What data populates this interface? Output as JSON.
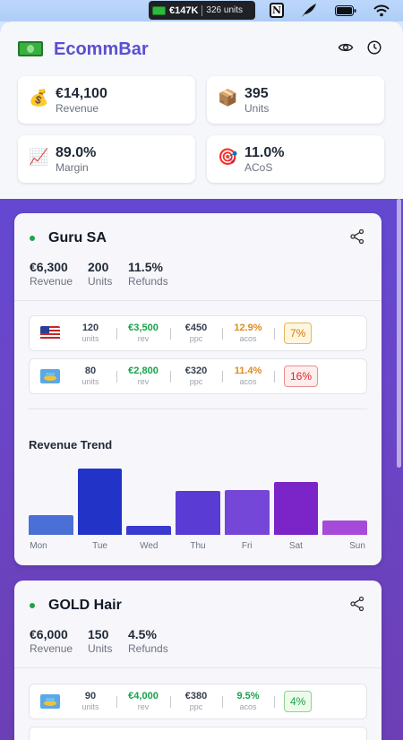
{
  "menubar": {
    "total": "€147K",
    "units": "326 units",
    "icons": [
      "cash-icon",
      "notion-icon",
      "feather-icon",
      "battery-icon",
      "wifi-icon"
    ],
    "notion_glyph": "N"
  },
  "app": {
    "title": "EcommBar",
    "accent": "#5b4ed2"
  },
  "stats": [
    {
      "emoji": "💰",
      "value": "€14,100",
      "label": "Revenue"
    },
    {
      "emoji": "📦",
      "value": "395",
      "label": "Units"
    },
    {
      "emoji": "📈",
      "value": "89.0%",
      "label": "Margin"
    },
    {
      "emoji": "🎯",
      "value": "11.0%",
      "label": "ACoS"
    }
  ],
  "products": [
    {
      "name": "Guru SA",
      "revenue": "€6,300",
      "revenue_label": "Revenue",
      "units": "200",
      "units_label": "Units",
      "refunds": "11.5%",
      "refunds_label": "Refunds",
      "markets": [
        {
          "flag": "us",
          "units": "120",
          "units_label": "units",
          "rev": "€3,500",
          "rev_label": "rev",
          "ppc": "€450",
          "ppc_label": "ppc",
          "acos": "12.9%",
          "acos_label": "acos",
          "pill": "7%",
          "pill_style": "orange"
        },
        {
          "flag": "sa",
          "units": "80",
          "units_label": "units",
          "rev": "€2,800",
          "rev_label": "rev",
          "ppc": "€320",
          "ppc_label": "ppc",
          "acos": "11.4%",
          "acos_label": "acos",
          "pill": "16%",
          "pill_style": "red"
        }
      ],
      "trend_title": "Revenue Trend",
      "chart_data": {
        "type": "bar",
        "categories": [
          "Mon",
          "Tue",
          "Wed",
          "Thu",
          "Fri",
          "Sat",
          "Sun"
        ],
        "values": [
          30,
          100,
          13,
          66,
          67,
          80,
          22
        ],
        "colors": [
          "#4a6fd6",
          "#2233c8",
          "#3a3ad0",
          "#5a3bd4",
          "#7447d8",
          "#7b24c8",
          "#a64ad9"
        ],
        "ylim": [
          0,
          100
        ]
      }
    },
    {
      "name": "GOLD Hair",
      "revenue": "€6,000",
      "revenue_label": "Revenue",
      "units": "150",
      "units_label": "Units",
      "refunds": "4.5%",
      "refunds_label": "Refunds",
      "markets": [
        {
          "flag": "sa",
          "units": "90",
          "units_label": "units",
          "rev": "€4,000",
          "rev_label": "rev",
          "ppc": "€380",
          "ppc_label": "ppc",
          "acos": "9.5%",
          "acos_label": "acos",
          "pill": "4%",
          "pill_style": "green"
        },
        {
          "flag": "us",
          "units": "",
          "units_label": "",
          "rev": "",
          "rev_label": "",
          "ppc": "",
          "ppc_label": "",
          "acos": "",
          "acos_label": "",
          "pill": "",
          "pill_style": "green"
        }
      ]
    }
  ]
}
